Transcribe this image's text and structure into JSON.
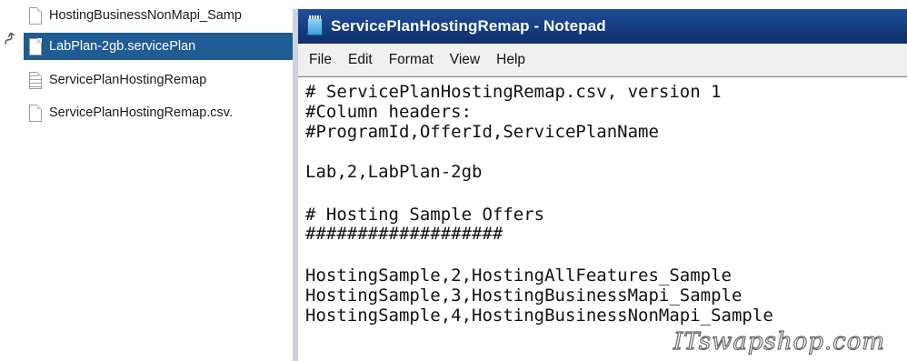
{
  "explorer": {
    "nav_glyph": "↝",
    "files": [
      {
        "name": "HostingBusinessNonMapi_Samp",
        "icon": "file-icon",
        "selected": false
      },
      {
        "name": "LabPlan-2gb.servicePlan",
        "icon": "file-icon",
        "selected": true
      },
      {
        "name": "ServicePlanHostingRemap",
        "icon": "text-file-icon",
        "selected": false
      },
      {
        "name": "ServicePlanHostingRemap.csv.",
        "icon": "file-icon",
        "selected": false
      }
    ]
  },
  "notepad": {
    "title": "ServicePlanHostingRemap - Notepad",
    "menu": [
      "File",
      "Edit",
      "Format",
      "View",
      "Help"
    ],
    "lines": [
      "# ServicePlanHostingRemap.csv, version 1",
      "#Column headers:",
      "#ProgramId,OfferId,ServicePlanName",
      "",
      "Lab,2,LabPlan-2gb",
      "",
      "# Hosting Sample Offers",
      "###################",
      "",
      "HostingSample,2,HostingAllFeatures_Sample",
      "HostingSample,3,HostingBusinessMapi_Sample",
      "HostingSample,4,HostingBusinessNonMapi_Sample"
    ]
  },
  "watermark": "ITswapshop.com",
  "colors": {
    "selection": "#1f5c94",
    "titlebar": "#153d80",
    "menubar": "#f0f0f0"
  }
}
